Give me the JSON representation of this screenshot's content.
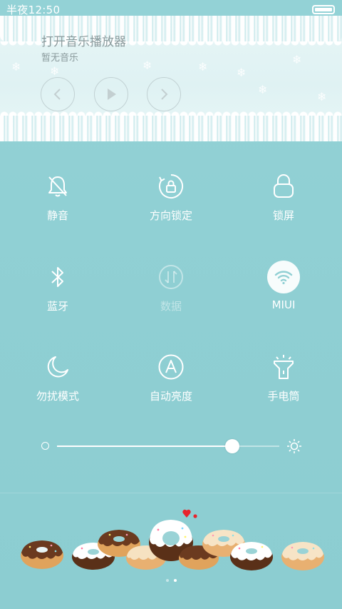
{
  "status_bar": {
    "time": "半夜12:50"
  },
  "music": {
    "title": "打开音乐播放器",
    "subtitle": "暂无音乐",
    "controls": [
      "previous-icon",
      "play-icon",
      "next-icon"
    ]
  },
  "toggles": [
    {
      "label": "静音",
      "icon": "bell-off-icon",
      "state": "off"
    },
    {
      "label": "方向锁定",
      "icon": "rotation-lock-icon",
      "state": "off"
    },
    {
      "label": "锁屏",
      "icon": "lock-icon",
      "state": "off"
    },
    {
      "label": "蓝牙",
      "icon": "bluetooth-icon",
      "state": "off"
    },
    {
      "label": "数据",
      "icon": "mobile-data-icon",
      "state": "disabled"
    },
    {
      "label": "MIUI",
      "icon": "wifi-icon",
      "state": "on"
    },
    {
      "label": "勿扰模式",
      "icon": "moon-icon",
      "state": "off"
    },
    {
      "label": "自动亮度",
      "icon": "auto-brightness-icon",
      "state": "off"
    },
    {
      "label": "手电筒",
      "icon": "flashlight-icon",
      "state": "off"
    }
  ],
  "brightness": {
    "level": 0.79
  },
  "pager": {
    "count": 2,
    "active": 1
  },
  "colors": {
    "background": "#92d0d4",
    "foreground": "#ffffff",
    "music_text": "#8a9a9c",
    "wifi_active": "#92d0d4"
  }
}
